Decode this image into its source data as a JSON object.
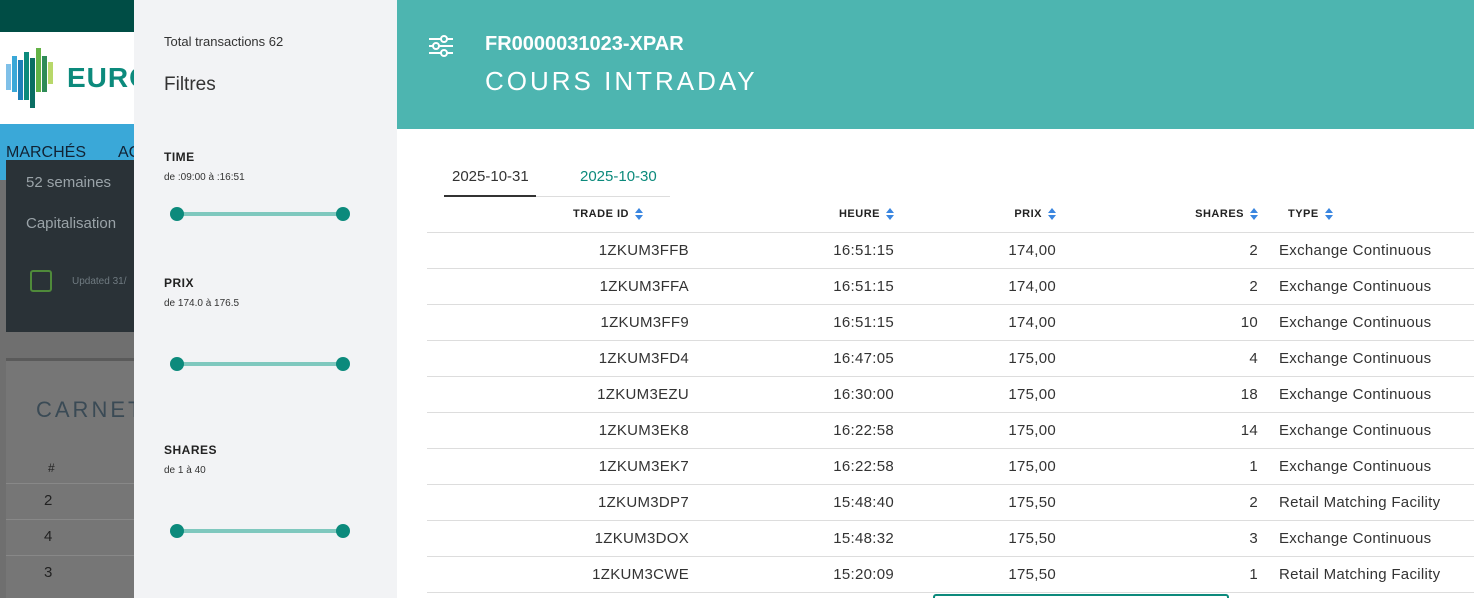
{
  "background": {
    "logo_text": "EURO",
    "nav_items": [
      "MARCHÉS",
      "AC"
    ],
    "card_lines": [
      "52 semaines",
      "Capitalisation"
    ],
    "updated_text": "Updated 31/",
    "carnet_title": "CARNET",
    "carnet_hash": "#",
    "carnet_rows": [
      "2",
      "4",
      "3"
    ]
  },
  "filters": {
    "total_label": "Total transactions 62",
    "title": "Filtres",
    "groups": [
      {
        "label": "TIME",
        "range": "de :09:00 à :16:51"
      },
      {
        "label": "PRIX",
        "range": "de 174.0  à 176.5"
      },
      {
        "label": "SHARES",
        "range": "de 1  à 40"
      }
    ]
  },
  "header": {
    "isin": "FR0000031023-XPAR",
    "subtitle": "COURS INTRADAY",
    "icon": "filter-sliders-icon"
  },
  "tabs": [
    "2025-10-31",
    "2025-10-30"
  ],
  "table": {
    "columns": [
      "TRADE ID",
      "HEURE",
      "PRIX",
      "SHARES",
      "TYPE"
    ],
    "rows": [
      [
        "1ZKUM3FFB",
        "16:51:15",
        "174,00",
        "2",
        "Exchange Continuous"
      ],
      [
        "1ZKUM3FFA",
        "16:51:15",
        "174,00",
        "2",
        "Exchange Continuous"
      ],
      [
        "1ZKUM3FF9",
        "16:51:15",
        "174,00",
        "10",
        "Exchange Continuous"
      ],
      [
        "1ZKUM3FD4",
        "16:47:05",
        "175,00",
        "4",
        "Exchange Continuous"
      ],
      [
        "1ZKUM3EZU",
        "16:30:00",
        "175,00",
        "18",
        "Exchange Continuous"
      ],
      [
        "1ZKUM3EK8",
        "16:22:58",
        "175,00",
        "14",
        "Exchange Continuous"
      ],
      [
        "1ZKUM3EK7",
        "16:22:58",
        "175,00",
        "1",
        "Exchange Continuous"
      ],
      [
        "1ZKUM3DP7",
        "15:48:40",
        "175,50",
        "2",
        "Retail Matching Facility"
      ],
      [
        "1ZKUM3DOX",
        "15:48:32",
        "175,50",
        "3",
        "Exchange Continuous"
      ],
      [
        "1ZKUM3CWE",
        "15:20:09",
        "175,50",
        "1",
        "Retail Matching Facility"
      ]
    ]
  },
  "colors": {
    "accent": "#0c8a7c",
    "header": "#4db5b0",
    "sort_arrow": "#3a86e0"
  }
}
